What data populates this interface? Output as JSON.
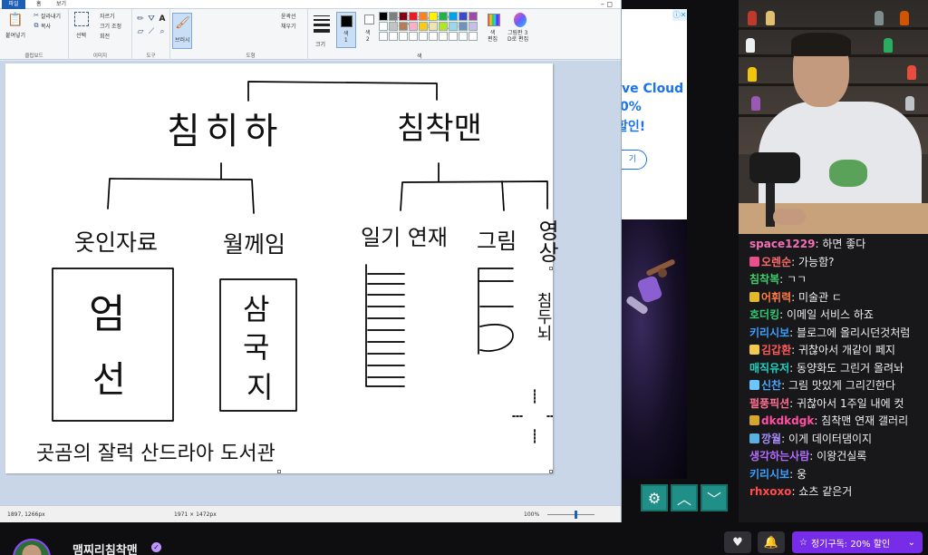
{
  "paint": {
    "tabs": [
      "파일",
      "홈",
      "보기"
    ],
    "window_controls": "– ◻",
    "clipboard": {
      "paste": "붙여넣기",
      "cut": "잘라내기",
      "copy": "복사",
      "label": "클립보드"
    },
    "image": {
      "select": "선택",
      "crop": "자르기",
      "resize": "크기 조정",
      "rotate": "회전",
      "label": "이미지"
    },
    "tools": {
      "label": "도구"
    },
    "brushes": {
      "label": "브러시"
    },
    "shapes": {
      "outline": "윤곽선",
      "fill": "채우기",
      "label": "도형"
    },
    "size": {
      "label": "크기"
    },
    "color1": {
      "label": "색\n1"
    },
    "color2": {
      "label": "색\n2"
    },
    "edit_colors": "색\n편집",
    "paint3d": "그림판 3\nD로 편집",
    "colors_label": "색",
    "palette": [
      "#000000",
      "#7f7f7f",
      "#880015",
      "#ed1c24",
      "#ff7f27",
      "#fff200",
      "#22b14c",
      "#00a2e8",
      "#3f48cc",
      "#a349a4",
      "#ffffff",
      "#c3c3c3",
      "#b97a57",
      "#ffaec9",
      "#ffc90e",
      "#efe4b0",
      "#b5e61d",
      "#99d9ea",
      "#7092be",
      "#c8bfe7",
      "#ffffff",
      "#ffffff",
      "#ffffff",
      "#ffffff",
      "#ffffff",
      "#ffffff",
      "#ffffff",
      "#ffffff",
      "#ffffff",
      "#ffffff"
    ],
    "status": {
      "cursor": "1897, 1266px",
      "canvas_size": "1971 × 1472px",
      "zoom": "100%"
    }
  },
  "drawing": {
    "left_title": "침히하",
    "right_title": "침착맨",
    "branches": [
      "옷인자료",
      "월께임",
      "일기 연재",
      "그림",
      "영상"
    ],
    "box1": [
      "엄",
      "선"
    ],
    "box2": [
      "삼",
      "국",
      "지"
    ],
    "video_sub": "침두뇌",
    "footer": "곳곰의 잘럭 산드라아 도서관"
  },
  "ad": {
    "line1": "ve Cloud",
    "line2": "0%",
    "line3": "할인!",
    "cta": "기"
  },
  "chat": [
    {
      "user": "space1229",
      "color": "#f36fb6",
      "text": "하면 좋다",
      "badge": ""
    },
    {
      "user": "오렌순",
      "color": "#ff6b6b",
      "text": "가능함?",
      "badge": "#e94f8a"
    },
    {
      "user": "침착복",
      "color": "#3ccf6b",
      "text": "ㄱㄱ",
      "badge": ""
    },
    {
      "user": "어휘력",
      "color": "#ff7a45",
      "text": "미술관 ㄷ",
      "badge": "#e5b82a"
    },
    {
      "user": "호더킹",
      "color": "#2ecc71",
      "text": "이메일 서비스 하죠",
      "badge": ""
    },
    {
      "user": "키리시보",
      "color": "#3aa0ff",
      "text": "블로그에 올리시던것처럼",
      "badge": ""
    },
    {
      "user": "김갑환",
      "color": "#ff5a5a",
      "text": "귀찮아서 개같이 페지",
      "badge": "#f2c94c"
    },
    {
      "user": "매직유저",
      "color": "#1fd1c1",
      "text": "동양화도 그린거 올려놔",
      "badge": ""
    },
    {
      "user": "신찬",
      "color": "#4aa8ff",
      "text": "그림 맛있게 그리긴한다",
      "badge": "#6bc5ff"
    },
    {
      "user": "펄풍픽션",
      "color": "#ff6f91",
      "text": "귀찮아서 1주일 내에 컷",
      "badge": ""
    },
    {
      "user": "dkdkdgk",
      "color": "#ff4fa3",
      "text": "침착맨 연재 갤러리",
      "badge": "#d4a72c"
    },
    {
      "user": "깡월",
      "color": "#a78bfa",
      "text": "이게 데이터댐이지",
      "badge": "#5ab0e0"
    },
    {
      "user": "생각하는사람",
      "color": "#b36bff",
      "text": "이왕건실록",
      "badge": ""
    },
    {
      "user": "키리시보",
      "color": "#3aa0ff",
      "text": "웅",
      "badge": ""
    },
    {
      "user": "rhxoxo",
      "color": "#ff4c4c",
      "text": "쇼츠 같은거",
      "badge": ""
    }
  ],
  "bottom": {
    "channel": "맴찌리침착맨",
    "subscribe": "정기구독: 20% 할인"
  },
  "controls": {
    "settings": "⚙",
    "up": "︿",
    "down": "﹀"
  }
}
